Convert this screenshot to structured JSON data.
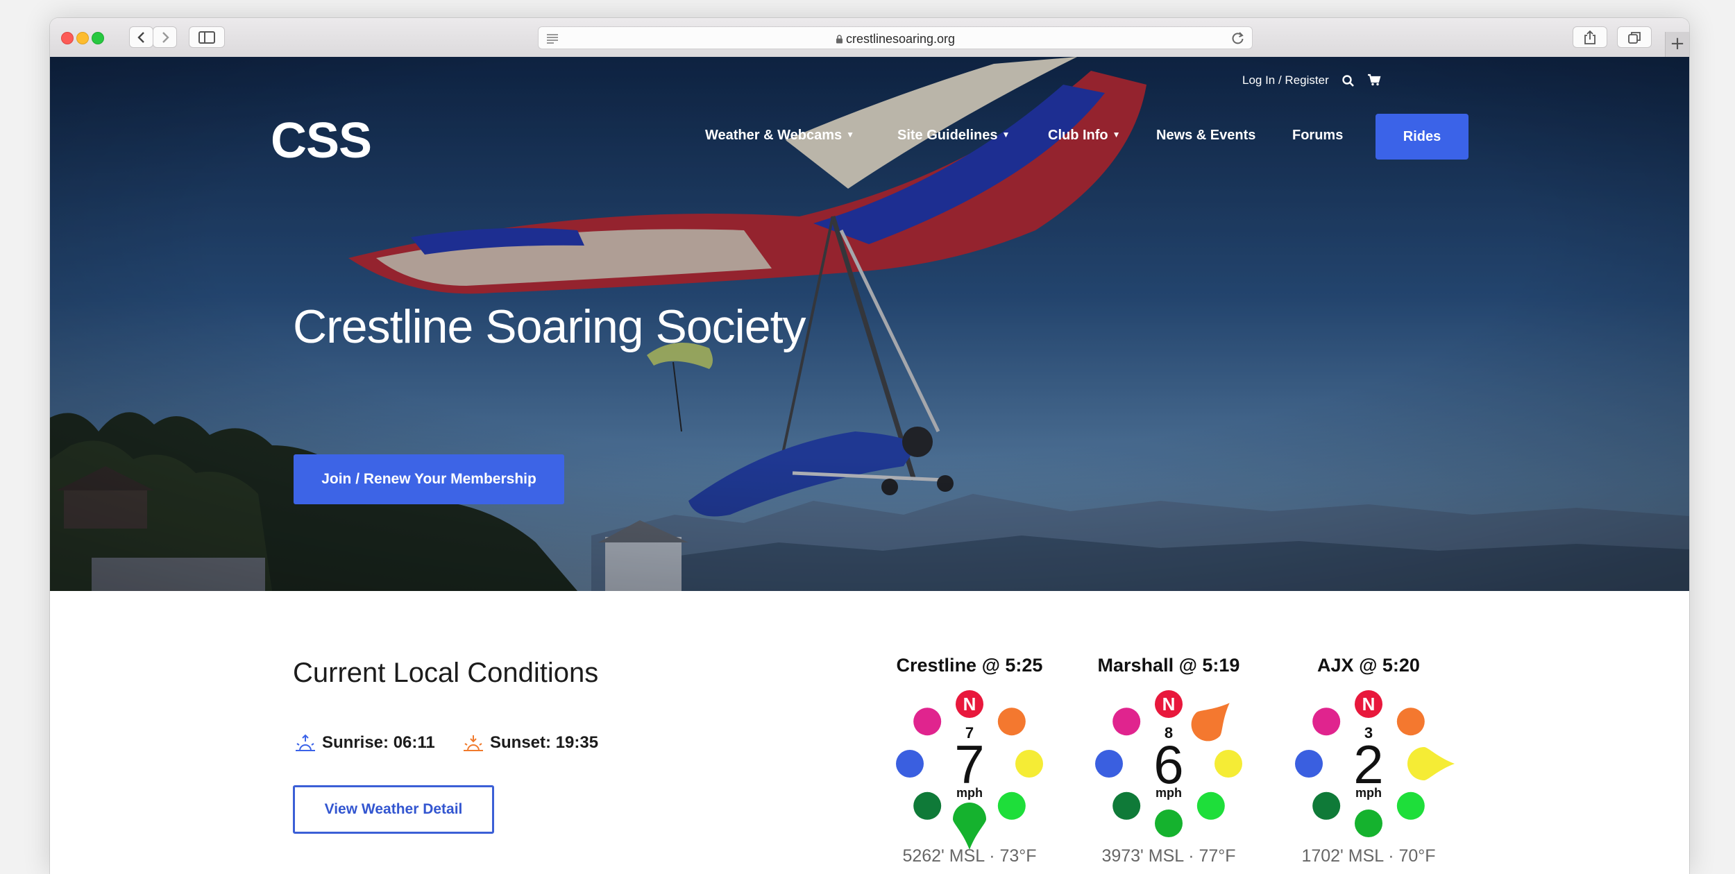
{
  "browser": {
    "url": "crestlinesoaring.org",
    "new_tab_label": "+"
  },
  "site": {
    "logo_text": "CSS",
    "topbar": {
      "login": "Log In / Register"
    },
    "nav": [
      {
        "label": "Weather & Webcams",
        "has_dropdown": true
      },
      {
        "label": "Site Guidelines",
        "has_dropdown": true
      },
      {
        "label": "Club Info",
        "has_dropdown": true
      },
      {
        "label": "News & Events",
        "has_dropdown": false
      },
      {
        "label": "Forums",
        "has_dropdown": false
      }
    ],
    "rides_button": "Rides",
    "hero_title": "Crestline Soaring Society",
    "join_button": "Join / Renew Your Membership",
    "accent_color": "#3d64e6"
  },
  "conditions": {
    "title": "Current Local Conditions",
    "sunrise": "Sunrise: 06:11",
    "sunset": "Sunset: 19:35",
    "weather_button": "View Weather Detail",
    "stations": [
      {
        "title": "Crestline @ 5:25",
        "gust": "7",
        "speed": "7",
        "unit": "mph",
        "altitude": "5262' MSL · 73°F",
        "pointer_dir": "S"
      },
      {
        "title": "Marshall @ 5:19",
        "gust": "8",
        "speed": "6",
        "unit": "mph",
        "altitude": "3973' MSL · 77°F",
        "pointer_dir": "NE"
      },
      {
        "title": "AJX @ 5:20",
        "gust": "3",
        "speed": "2",
        "unit": "mph",
        "altitude": "1702' MSL · 70°F",
        "pointer_dir": "E"
      }
    ],
    "compass_north": "N"
  }
}
